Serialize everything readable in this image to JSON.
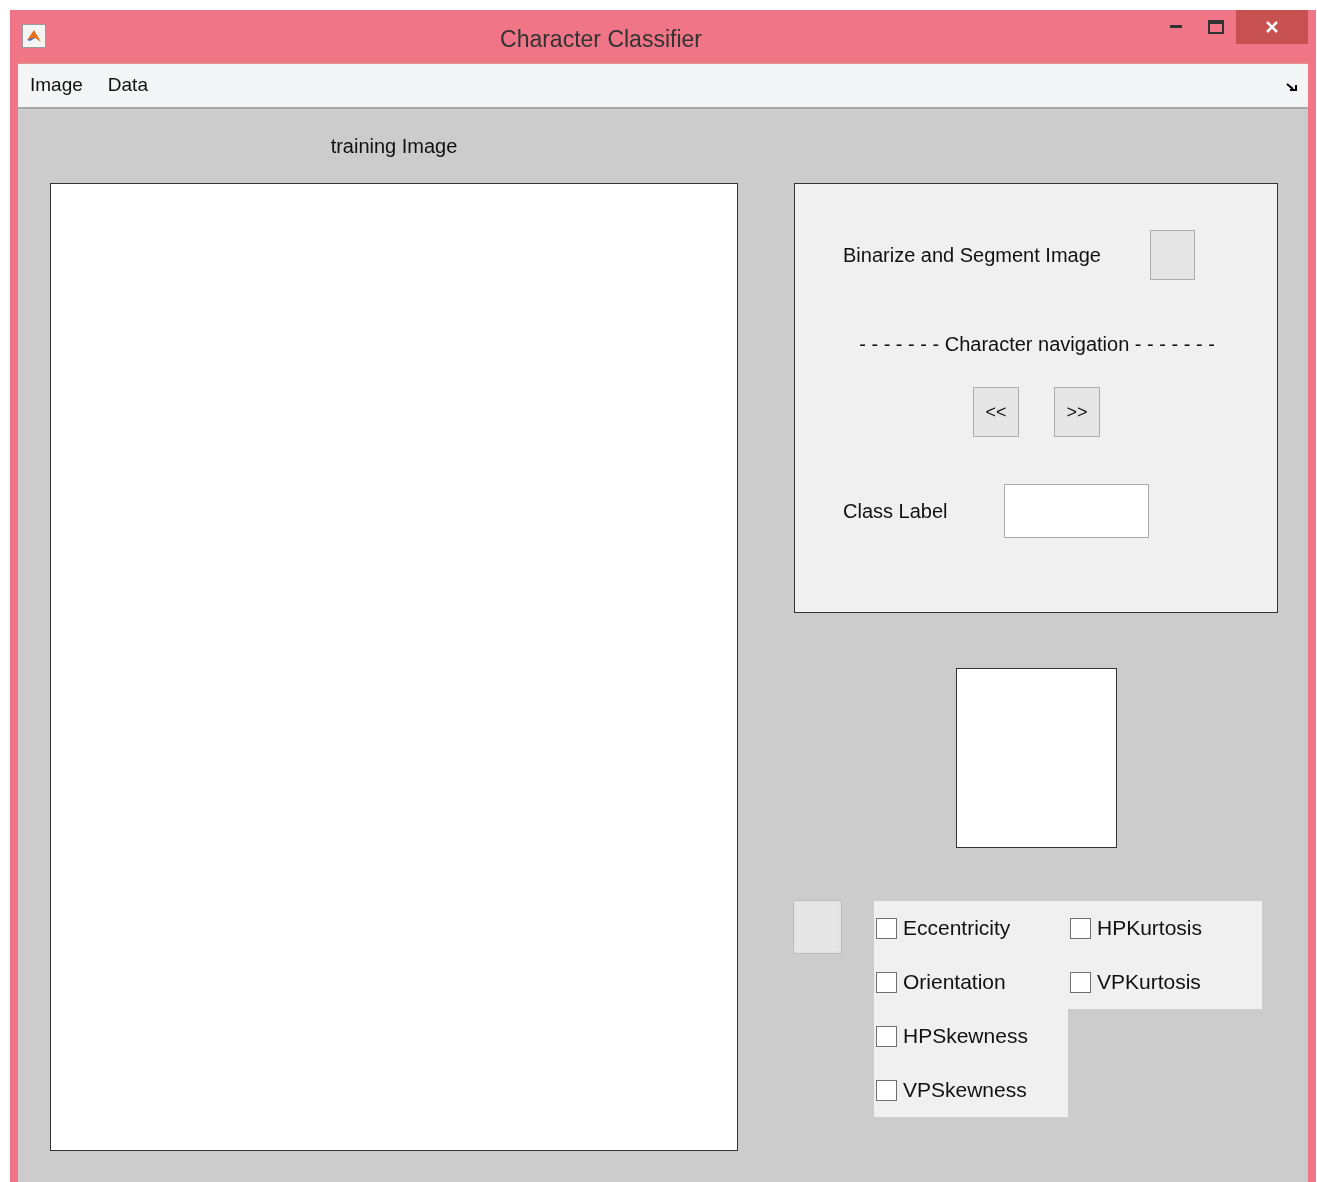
{
  "window": {
    "title": "Character Classifier"
  },
  "menu": [
    "Image",
    "Data"
  ],
  "training_image": {
    "label": "training Image"
  },
  "segment_panel": {
    "binarize_label": "Binarize and Segment Image",
    "navigation_label": "- - - - - - - Character navigation - - - - - - -",
    "prev_button": "<<",
    "next_button": ">>",
    "class_label": "Class Label"
  },
  "feature_columns": [
    [
      {
        "label": "Eccentricity",
        "checked": false
      },
      {
        "label": "Orientation",
        "checked": false
      },
      {
        "label": "HPSkewness",
        "checked": false
      },
      {
        "label": "VPSkewness",
        "checked": false
      }
    ],
    [
      {
        "label": "HPKurtosis",
        "checked": false
      },
      {
        "label": "VPKurtosis",
        "checked": false
      }
    ]
  ]
}
